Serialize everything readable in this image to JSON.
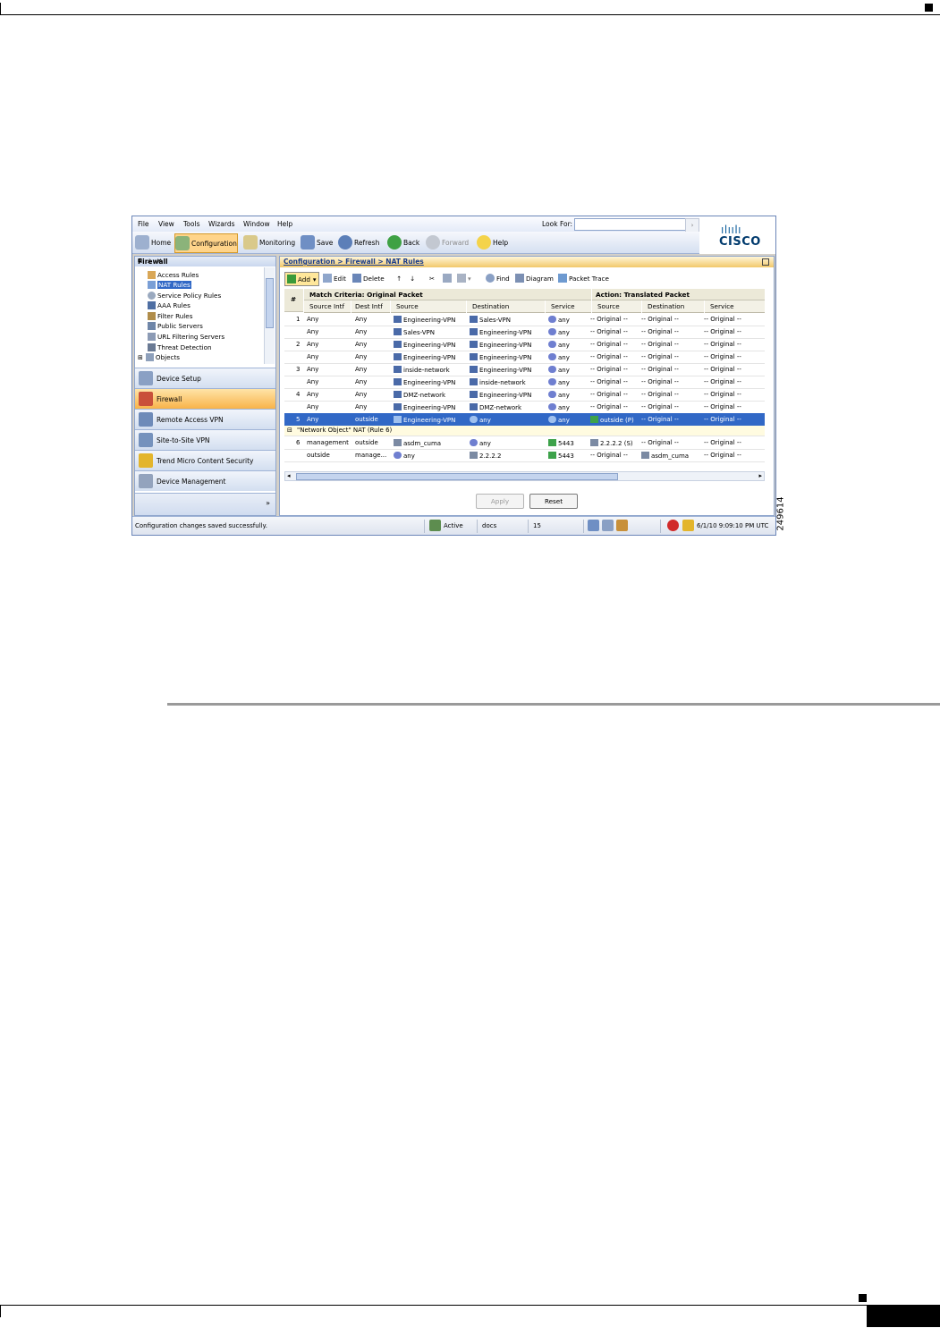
{
  "figure_id": "249614",
  "menubar": {
    "items": [
      "File",
      "View",
      "Tools",
      "Wizards",
      "Window",
      "Help"
    ],
    "lookfor_label": "Look For:",
    "lookfor_value": ""
  },
  "toolbar": {
    "home": "Home",
    "configuration": "Configuration",
    "monitoring": "Monitoring",
    "save": "Save",
    "refresh": "Refresh",
    "back": "Back",
    "forward": "Forward",
    "help": "Help"
  },
  "logo": {
    "bars": "ılıılı",
    "word": "CISCO"
  },
  "nav": {
    "title": "Firewall",
    "tree": [
      "Access Rules",
      "NAT Rules",
      "Service Policy Rules",
      "AAA Rules",
      "Filter Rules",
      "Public Servers",
      "URL Filtering Servers",
      "Threat Detection",
      "Objects"
    ],
    "selected_index": 1,
    "buttons": [
      "Device Setup",
      "Firewall",
      "Remote Access VPN",
      "Site-to-Site VPN",
      "Trend Micro Content Security",
      "Device Management"
    ],
    "active_button": "Firewall"
  },
  "main": {
    "breadcrumb": "Configuration > Firewall > NAT Rules",
    "rule_toolbar": {
      "add": "Add",
      "edit": "Edit",
      "delete": "Delete",
      "find": "Find",
      "diagram": "Diagram",
      "packet_trace": "Packet Trace"
    },
    "table": {
      "group_headers": {
        "match": "Match Criteria: Original Packet",
        "action": "Action: Translated Packet"
      },
      "columns": [
        "#",
        "Source Intf",
        "Dest Intf",
        "Source",
        "Destination",
        "Service",
        "Source",
        "Destination",
        "Service"
      ],
      "rows": [
        {
          "num": "1",
          "src_intf": "Any",
          "dst_intf": "Any",
          "src": "Engineering-VPN",
          "dst": "Sales-VPN",
          "svc": "any",
          "t_src": "-- Original --",
          "t_dst": "-- Original --",
          "t_svc": "-- Original --"
        },
        {
          "num": "",
          "src_intf": "Any",
          "dst_intf": "Any",
          "src": "Sales-VPN",
          "dst": "Engineering-VPN",
          "svc": "any",
          "t_src": "-- Original --",
          "t_dst": "-- Original --",
          "t_svc": "-- Original --"
        },
        {
          "num": "2",
          "src_intf": "Any",
          "dst_intf": "Any",
          "src": "Engineering-VPN",
          "dst": "Engineering-VPN",
          "svc": "any",
          "t_src": "-- Original --",
          "t_dst": "-- Original --",
          "t_svc": "-- Original --"
        },
        {
          "num": "",
          "src_intf": "Any",
          "dst_intf": "Any",
          "src": "Engineering-VPN",
          "dst": "Engineering-VPN",
          "svc": "any",
          "t_src": "-- Original --",
          "t_dst": "-- Original --",
          "t_svc": "-- Original --"
        },
        {
          "num": "3",
          "src_intf": "Any",
          "dst_intf": "Any",
          "src": "inside-network",
          "dst": "Engineering-VPN",
          "svc": "any",
          "t_src": "-- Original --",
          "t_dst": "-- Original --",
          "t_svc": "-- Original --"
        },
        {
          "num": "",
          "src_intf": "Any",
          "dst_intf": "Any",
          "src": "Engineering-VPN",
          "dst": "inside-network",
          "svc": "any",
          "t_src": "-- Original --",
          "t_dst": "-- Original --",
          "t_svc": "-- Original --"
        },
        {
          "num": "4",
          "src_intf": "Any",
          "dst_intf": "Any",
          "src": "DMZ-network",
          "dst": "Engineering-VPN",
          "svc": "any",
          "t_src": "-- Original --",
          "t_dst": "-- Original --",
          "t_svc": "-- Original --"
        },
        {
          "num": "",
          "src_intf": "Any",
          "dst_intf": "Any",
          "src": "Engineering-VPN",
          "dst": "DMZ-network",
          "svc": "any",
          "t_src": "-- Original --",
          "t_dst": "-- Original --",
          "t_svc": "-- Original --"
        },
        {
          "num": "5",
          "src_intf": "Any",
          "dst_intf": "outside",
          "src": "Engineering-VPN",
          "dst": "any",
          "svc": "any",
          "t_src": "outside (P)",
          "t_dst": "-- Original --",
          "t_svc": "-- Original --",
          "selected": true
        }
      ],
      "group_row": "\"Network Object\" NAT (Rule 6)",
      "object_rows": [
        {
          "num": "6",
          "src_intf": "management",
          "dst_intf": "outside",
          "src": "asdm_cuma",
          "dst": "any",
          "svc": "5443",
          "t_src": "2.2.2.2 (S)",
          "t_dst": "-- Original --",
          "t_svc": "-- Original --"
        },
        {
          "num": "",
          "src_intf": "outside",
          "dst_intf": "manage...",
          "src": "any",
          "dst": "2.2.2.2",
          "svc": "5443",
          "t_src": "-- Original --",
          "t_dst": "asdm_cuma",
          "t_svc": "-- Original --"
        }
      ]
    },
    "apply": "Apply",
    "reset": "Reset"
  },
  "status": {
    "message": "Configuration changes saved successfully.",
    "state": "Active",
    "user": "docs",
    "privilege": "15",
    "datetime": "6/1/10 9:09:10 PM UTC"
  },
  "colors": {
    "selection": "#3168c6",
    "accent": "#f8b34a",
    "brand": "#0d5e9c"
  }
}
